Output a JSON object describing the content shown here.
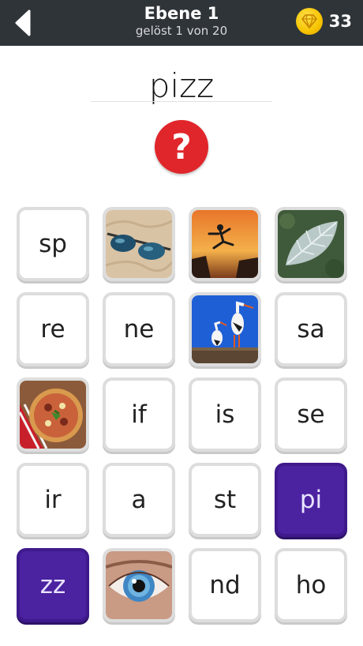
{
  "header": {
    "title": "Ebene 1",
    "subtitle": "gelöst 1 von 20",
    "coins": "33"
  },
  "answer": "pizz",
  "tiles": [
    {
      "type": "text",
      "label": "sp"
    },
    {
      "type": "image",
      "icon": "sunglasses-on-sand"
    },
    {
      "type": "image",
      "icon": "jump-sunset"
    },
    {
      "type": "image",
      "icon": "frosted-leaf"
    },
    {
      "type": "text",
      "label": "re"
    },
    {
      "type": "text",
      "label": "ne"
    },
    {
      "type": "image",
      "icon": "storks"
    },
    {
      "type": "text",
      "label": "sa"
    },
    {
      "type": "image",
      "icon": "pizza"
    },
    {
      "type": "text",
      "label": "if"
    },
    {
      "type": "text",
      "label": "is"
    },
    {
      "type": "text",
      "label": "se"
    },
    {
      "type": "text",
      "label": "ir"
    },
    {
      "type": "text",
      "label": "a"
    },
    {
      "type": "text",
      "label": "st"
    },
    {
      "type": "text",
      "label": "pi",
      "selected": true
    },
    {
      "type": "text",
      "label": "zz",
      "selected": true
    },
    {
      "type": "image",
      "icon": "eye"
    },
    {
      "type": "text",
      "label": "nd"
    },
    {
      "type": "text",
      "label": "ho"
    }
  ],
  "colors": {
    "topbar": "#2f3439",
    "hint": "#e0262b",
    "selected": "#4b22a0",
    "coin": "#f6c400"
  }
}
